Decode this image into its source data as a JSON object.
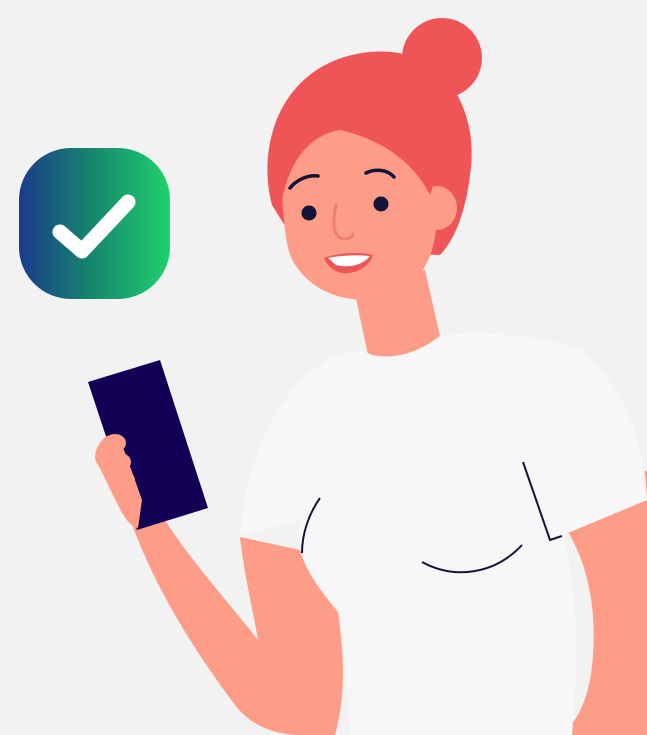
{
  "illustration": {
    "subject": "woman-holding-phone",
    "badge_icon": "checkmark-icon",
    "colors": {
      "background": "#f2f2f2",
      "skin": "#fe9d87",
      "hair": "#ef5456",
      "shirt": "#f7f7f9",
      "phone": "#110055",
      "ink": "#14143a",
      "badge_gradient_start": "#1b3a8c",
      "badge_gradient_end": "#1fd16d",
      "check": "#ffffff"
    }
  }
}
